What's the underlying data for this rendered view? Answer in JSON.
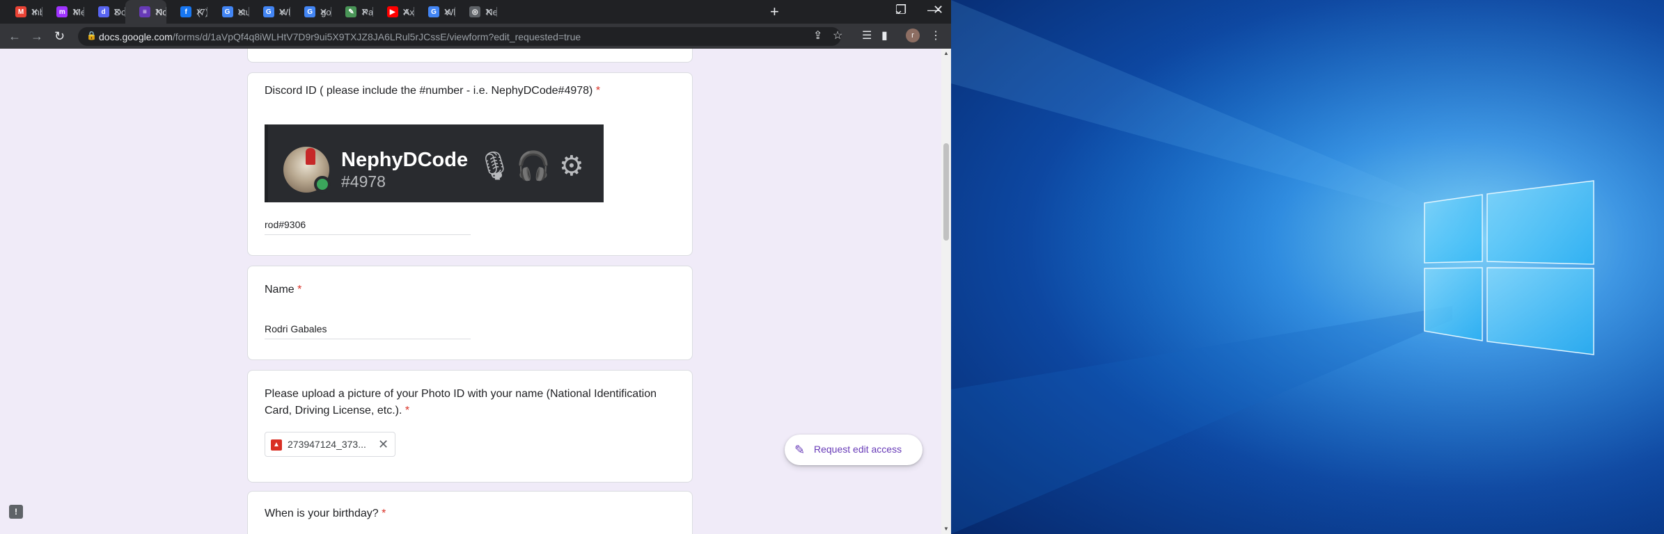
{
  "browser": {
    "tabs": [
      {
        "title": "Inbox",
        "icon": "gmail-icon",
        "color": "#ea4335",
        "glyph": "M"
      },
      {
        "title": "Messenger",
        "icon": "messenger-icon",
        "color": "#a033ff",
        "glyph": "m"
      },
      {
        "title": "Download",
        "icon": "discord-icon",
        "color": "#5865f2",
        "glyph": "d"
      },
      {
        "title": "Nox",
        "icon": "google-forms-icon",
        "color": "#673ab7",
        "glyph": "≡"
      },
      {
        "title": "(7) Rod",
        "icon": "facebook-icon",
        "color": "#1877f2",
        "glyph": "f"
      },
      {
        "title": "study",
        "icon": "google-icon",
        "color": "#4285f4",
        "glyph": "G"
      },
      {
        "title": "What",
        "icon": "google-icon",
        "color": "#4285f4",
        "glyph": "G"
      },
      {
        "title": "google",
        "icon": "google-icon",
        "color": "#4285f4",
        "glyph": "G"
      },
      {
        "title": "Paraphrase",
        "icon": "quill-icon",
        "color": "#499557",
        "glyph": "✎"
      },
      {
        "title": "Axie",
        "icon": "youtube-icon",
        "color": "#ff0000",
        "glyph": "▶"
      },
      {
        "title": "Why",
        "icon": "google-icon",
        "color": "#4285f4",
        "glyph": "G"
      },
      {
        "title": "New Tab",
        "icon": "chrome-icon",
        "color": "#5f6368",
        "glyph": "◎"
      }
    ],
    "active_tab": 3,
    "url_host": "docs.google.com",
    "url_path": "/forms/d/1aVpQf4q8iWLHtV7D9r9ui5X9TXJZ8JA6LRul5rJCssE/viewform?edit_requested=true",
    "profile_initial": "r"
  },
  "form": {
    "discord": {
      "title": "Discord ID ( please include the #number - i.e. NephyDCode#4978)",
      "required_mark": "*",
      "example_username": "NephyDCode",
      "example_tag": "#4978",
      "answer": "rod#9306"
    },
    "name": {
      "title": "Name",
      "required_mark": "*",
      "answer": "Rodri Gabales"
    },
    "photo_id": {
      "title": "Please upload a picture of your Photo ID with your name (National Identification Card, Driving License, etc.).",
      "required_mark": "*",
      "file_name": "273947124_373..."
    },
    "birthday": {
      "title": "When is your birthday?",
      "required_mark": "*"
    },
    "request_edit_label": "Request edit access"
  }
}
